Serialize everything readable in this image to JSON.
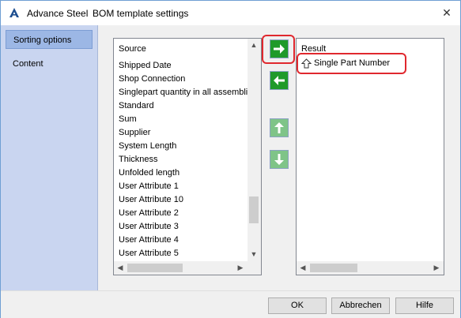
{
  "window": {
    "app_name": "Advance Steel",
    "dialog_title": "BOM template settings",
    "close_glyph": "✕"
  },
  "sidebar": {
    "items": [
      {
        "label": "Sorting options",
        "selected": true
      },
      {
        "label": "Content",
        "selected": false
      }
    ]
  },
  "source_list": {
    "header": "Source",
    "items": [
      "Shipped Date",
      "Shop Connection",
      "Singlepart quantity in all assemblies",
      "Standard",
      "Sum",
      "Supplier",
      "System Length",
      "Thickness",
      "Unfolded length",
      "User Attribute 1",
      "User Attribute 10",
      "User Attribute 2",
      "User Attribute 3",
      "User Attribute 4",
      "User Attribute 5"
    ]
  },
  "result_list": {
    "header": "Result",
    "items": [
      {
        "label": "Single Part Number",
        "sort": "ascending",
        "icon": "sort-ascending-icon"
      }
    ]
  },
  "movers": {
    "add": "arrow-right-icon",
    "remove": "arrow-left-icon",
    "up": "arrow-up-icon",
    "down": "arrow-down-icon"
  },
  "colors": {
    "mover_green": "#1f9a2a",
    "mover_disabled": "#7fc488",
    "highlight": "#e0282e",
    "sidebar_bg": "#c9d5f0"
  },
  "buttons": {
    "ok": "OK",
    "cancel": "Abbrechen",
    "help": "Hilfe"
  }
}
